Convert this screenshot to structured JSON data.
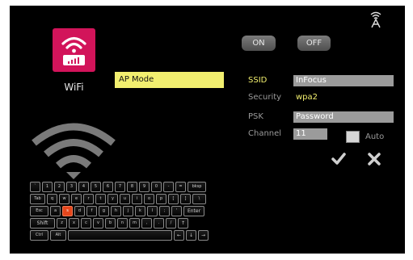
{
  "device": {
    "caption": "WiFi",
    "tile_color": "#d2145a",
    "tile_icon": "wifi-router-icon",
    "status_icon": "wireless-antenna-icon",
    "big_icon": "wifi-signal-icon"
  },
  "mode": {
    "label": "AP Mode"
  },
  "toggles": {
    "on_label": "ON",
    "off_label": "OFF"
  },
  "settings": {
    "ssid": {
      "label": "SSID",
      "value": "InFocus"
    },
    "security": {
      "label": "Security",
      "value": "wpa2"
    },
    "psk": {
      "label": "PSK",
      "value": "Password"
    },
    "channel": {
      "label": "Channel",
      "value": "11",
      "auto_label": "Auto",
      "auto_checked": false
    }
  },
  "actions": {
    "confirm_icon": "checkmark-icon",
    "cancel_icon": "close-icon"
  },
  "colors": {
    "accent": "#f2ef6f",
    "key_highlight": "#e5461c"
  },
  "keyboard": {
    "highlighted_key": "s",
    "rows": [
      [
        "`",
        "1",
        "2",
        "3",
        "4",
        "5",
        "6",
        "7",
        "8",
        "9",
        "0",
        "-",
        "=",
        "bksp"
      ],
      [
        "Tab",
        "q",
        "w",
        "e",
        "r",
        "t",
        "y",
        "u",
        "i",
        "o",
        "p",
        "[",
        "]",
        "\\"
      ],
      [
        "Esc",
        "a",
        "s",
        "d",
        "f",
        "g",
        "h",
        "j",
        "k",
        "l",
        ";",
        "'",
        "Enter"
      ],
      [
        "Shift",
        "z",
        "x",
        "c",
        "v",
        "b",
        "n",
        "m",
        ",",
        ".",
        "/",
        "↑"
      ],
      [
        "Ctrl",
        "Alt",
        "",
        "←",
        "↓",
        "→"
      ]
    ]
  }
}
